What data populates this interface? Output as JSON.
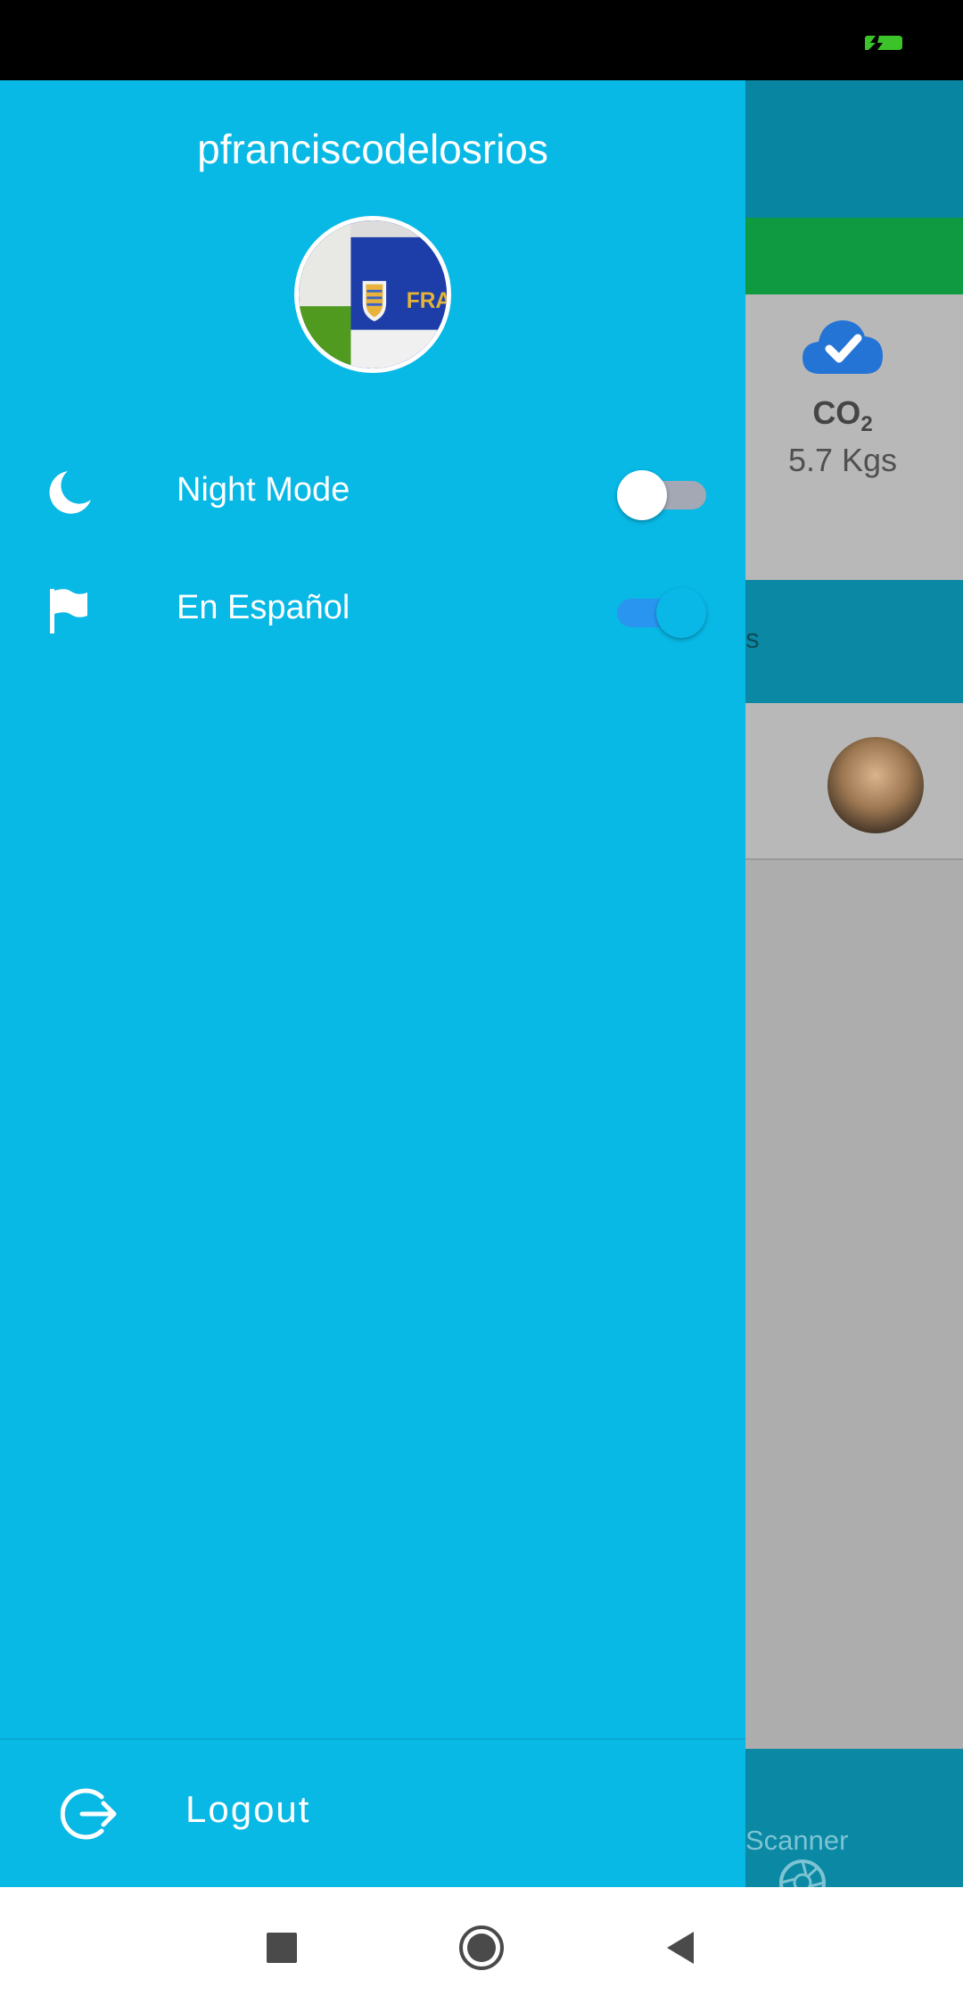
{
  "drawer": {
    "username": "pfranciscodelosrios",
    "avatar_icon": "profile-photo",
    "avatar_text": "FRA",
    "items": [
      {
        "icon": "moon-icon",
        "label": "Night Mode",
        "toggle_on": false
      },
      {
        "icon": "flag-icon",
        "label": "En Español",
        "toggle_on": true
      }
    ],
    "logout": {
      "icon": "logout-icon",
      "label": "Logout"
    }
  },
  "background": {
    "co2_label": "CO",
    "co2_sub": "2",
    "co2_value": "5.7 Kgs",
    "tab_text": "sers",
    "bottom_nav_label": "Scanner"
  },
  "colors": {
    "drawer": "#08b8e5",
    "toggle_on_track": "#2a95f0",
    "toggle_off_track": "#a3a8b4"
  }
}
